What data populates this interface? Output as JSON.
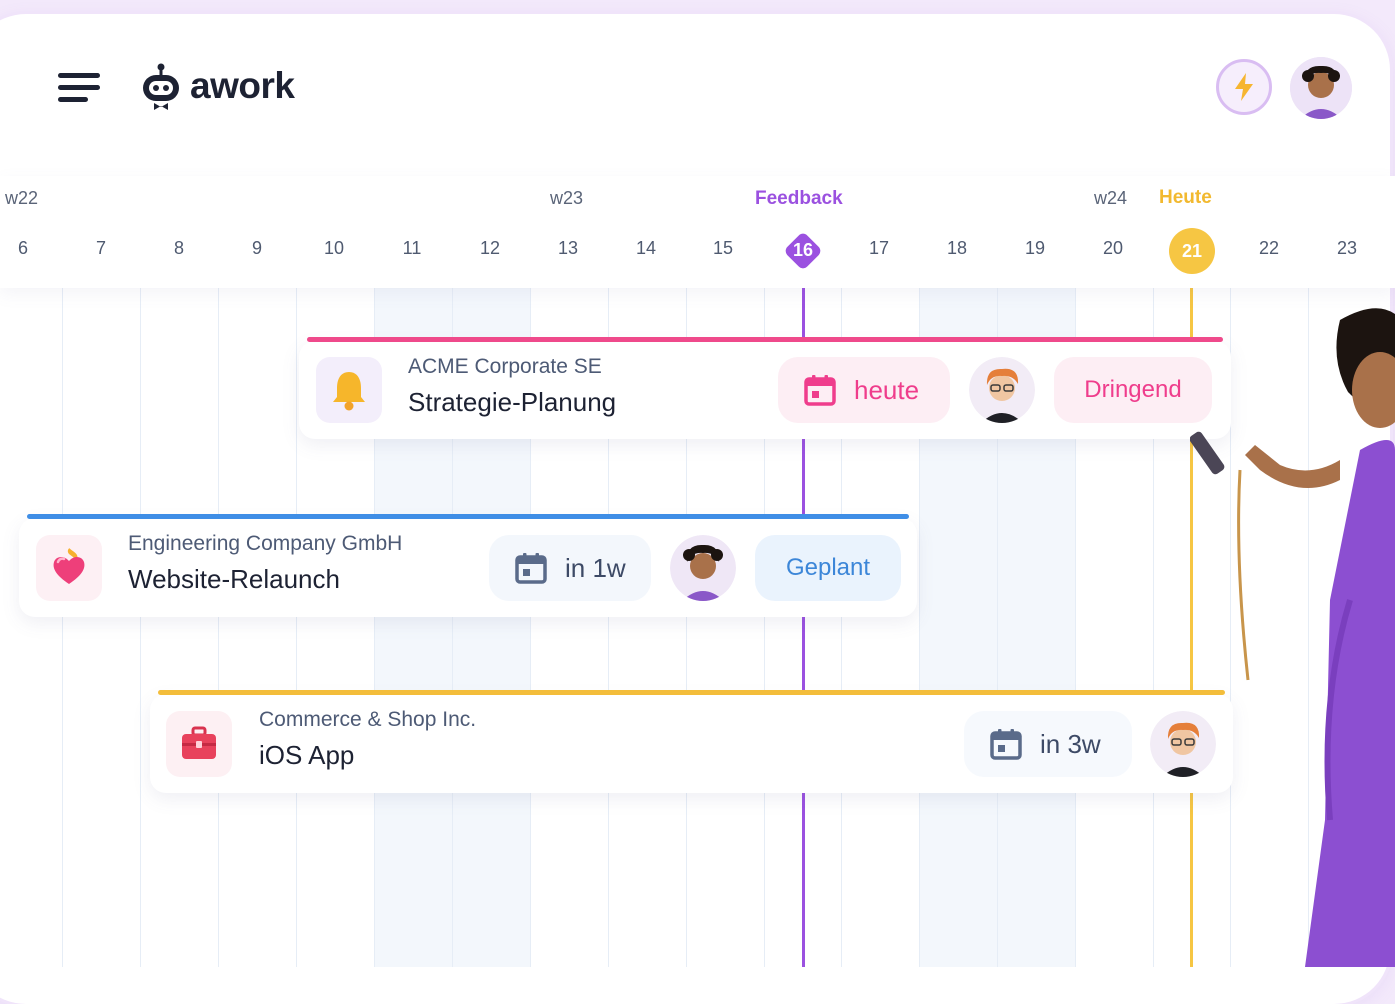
{
  "app": {
    "name": "awork"
  },
  "timeline": {
    "weeks": [
      {
        "label": "w22"
      },
      {
        "label": "w23"
      },
      {
        "label": "w24"
      }
    ],
    "days": [
      "6",
      "7",
      "8",
      "9",
      "10",
      "11",
      "12",
      "13",
      "14",
      "15",
      "16",
      "17",
      "18",
      "19",
      "20",
      "21",
      "22",
      "23"
    ],
    "markers": {
      "feedback": {
        "label": "Feedback",
        "day": "16",
        "color": "#9b51e0"
      },
      "today": {
        "label": "Heute",
        "day": "21",
        "color": "#f6c643"
      }
    }
  },
  "tasks": [
    {
      "company": "ACME Corporate SE",
      "title": "Strategie-Planung",
      "icon": "bell-icon",
      "bar_color": "#ef4a8b",
      "due": "heute",
      "status": "Dringend",
      "accent": "#ef3d8c"
    },
    {
      "company": "Engineering Company GmbH",
      "title": "Website-Relaunch",
      "icon": "heart-icon",
      "bar_color": "#3f8ee6",
      "due": "in 1w",
      "status": "Geplant",
      "accent": "#3c86d8"
    },
    {
      "company": "Commerce & Shop Inc.",
      "title": "iOS App",
      "icon": "toolbox-icon",
      "bar_color": "#f3bd3b",
      "due": "in 3w",
      "accent": "#5a6b8a"
    }
  ]
}
